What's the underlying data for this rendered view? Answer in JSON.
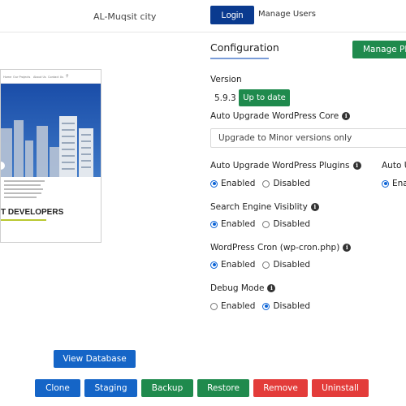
{
  "header": {
    "site_name": "AL-Muqsit city",
    "login_label": "Login",
    "manage_users_label": "Manage Users"
  },
  "preview": {
    "nav_items": [
      "Home",
      "Our Projects",
      "About Us",
      "Contact Us"
    ],
    "heading_text": "T DEVELOPERS"
  },
  "config": {
    "title": "Configuration",
    "manage_plugins_label": "Manage Pl",
    "version_label": "Version",
    "version_value": "5.9.3",
    "up_to_date_label": "Up to date",
    "core_label": "Auto Upgrade WordPress Core",
    "core_select_value": "Upgrade to Minor versions only",
    "plugins_label": "Auto Upgrade WordPress Plugins",
    "plugins_options": [
      "Enabled",
      "Disabled"
    ],
    "plugins_selected": "Enabled",
    "themes_label": "Auto U",
    "themes_option": "Ena",
    "seo_label": "Search Engine Visiblity",
    "seo_options": [
      "Enabled",
      "Disabled"
    ],
    "seo_selected": "Enabled",
    "cron_label": "WordPress Cron (wp-cron.php)",
    "cron_options": [
      "Enabled",
      "Disabled"
    ],
    "cron_selected": "Enabled",
    "debug_label": "Debug Mode",
    "debug_options": [
      "Enabled",
      "Disabled"
    ],
    "debug_selected": "Disabled",
    "info_glyph": "i"
  },
  "actions": {
    "view_database": "View Database",
    "clone": "Clone",
    "staging": "Staging",
    "backup": "Backup",
    "restore": "Restore",
    "remove": "Remove",
    "uninstall": "Uninstall"
  },
  "colors": {
    "primary_dark": "#0a3a8f",
    "primary": "#1565c7",
    "success": "#1f8a4d",
    "danger": "#e33c3a"
  }
}
